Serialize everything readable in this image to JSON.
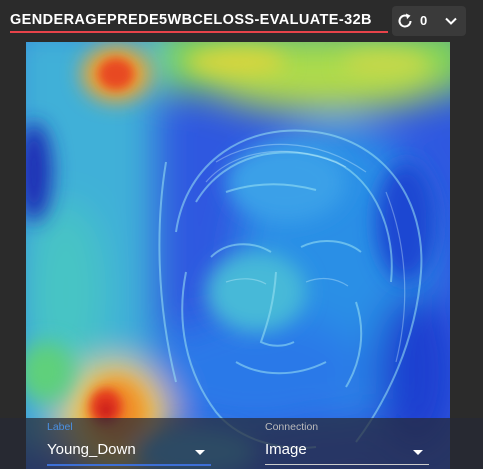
{
  "header": {
    "title": "GENDERAGEPREDE5WBCELOSS-EVALUATE-32B",
    "refresh_count": "0",
    "accent_color": "#e8434a"
  },
  "icons": {
    "refresh": "refresh-icon",
    "expand": "chevron-down-icon",
    "label_dropdown": "caret-down-icon",
    "connection_dropdown": "caret-down-icon"
  },
  "bottom": {
    "label": {
      "caption": "Label",
      "value": "Young_Down",
      "caption_color": "#4a90e2",
      "line_color": "#3d6fd6"
    },
    "connection": {
      "caption": "Connection",
      "value": "Image",
      "caption_color": "#bbbbbb",
      "line_color": "#cccccc"
    }
  }
}
